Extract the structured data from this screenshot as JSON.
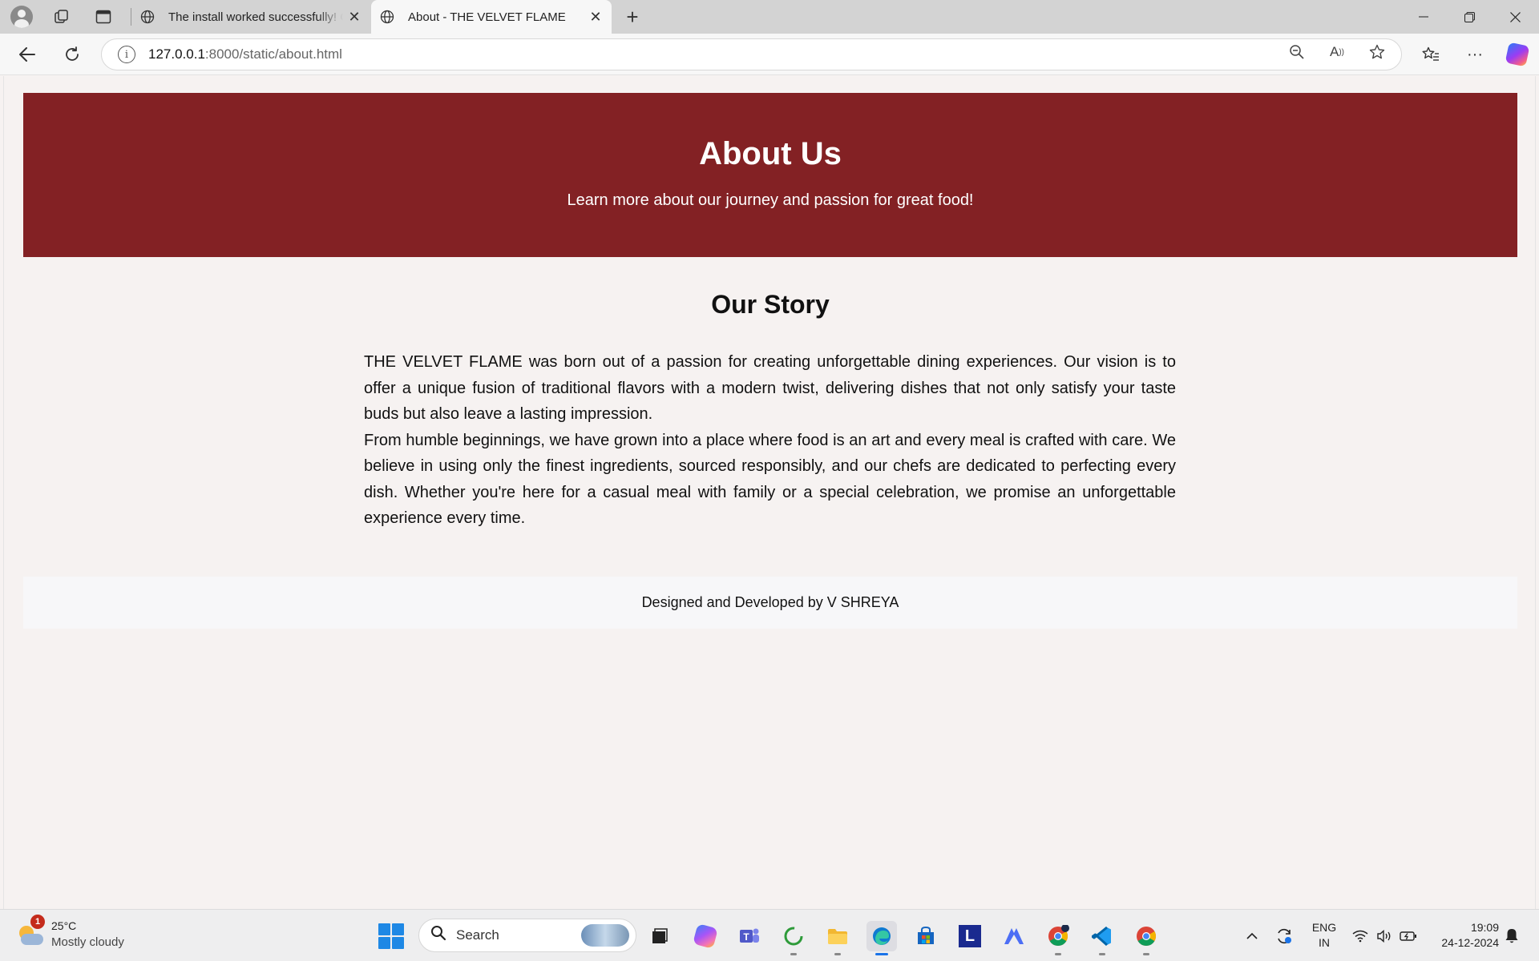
{
  "browser": {
    "tabs": [
      {
        "title": "The install worked successfully! Congratulations!",
        "active": false
      },
      {
        "title": "About - THE VELVET FLAME",
        "active": true
      }
    ],
    "address": {
      "host": "127.0.0.1",
      "path": ":8000/static/about.html"
    },
    "icons": [
      "profile-icon",
      "workspaces-icon",
      "tab-actions-icon",
      "globe-icon",
      "close-icon",
      "new-tab-icon",
      "back-icon",
      "refresh-icon",
      "info-icon",
      "zoom-out-icon",
      "read-aloud-icon",
      "favorite-star-icon",
      "favorites-icon",
      "more-icon",
      "copilot-icon",
      "minimize-icon",
      "restore-icon",
      "window-close-icon"
    ]
  },
  "page": {
    "hero": {
      "title": "About Us",
      "subtitle": "Learn more about our journey and passion for great food!"
    },
    "story": {
      "title": "Our Story",
      "paragraphs": [
        "THE VELVET FLAME was born out of a passion for creating unforgettable dining experiences. Our vision is to offer a unique fusion of traditional flavors with a modern twist, delivering dishes that not only satisfy your taste buds but also leave a lasting impression.",
        "From humble beginnings, we have grown into a place where food is an art and every meal is crafted with care. We believe in using only the finest ingredients, sourced responsibly, and our chefs are dedicated to perfecting every dish. Whether you're here for a casual meal with family or a special celebration, we promise an unforgettable experience every time."
      ]
    },
    "footer": {
      "text": "Designed and Developed by V SHREYA"
    },
    "colors": {
      "hero_bg": "#832124",
      "page_bg": "#f6f2f1",
      "footer_bg": "#f7f7f9"
    }
  },
  "taskbar": {
    "weather": {
      "badge": "1",
      "temp": "25°C",
      "condition": "Mostly cloudy"
    },
    "search": {
      "label": "Search"
    },
    "apps": [
      "file-explorer-dark-icon",
      "copilot-icon",
      "teams-icon",
      "refresh-app-icon",
      "folder-icon",
      "edge-icon",
      "store-icon",
      "l-app-icon",
      "vpn-icon",
      "chrome-icon",
      "vscode-icon",
      "chrome-icon"
    ],
    "tray": {
      "lang_line1": "ENG",
      "lang_line2": "IN",
      "time": "19:09",
      "date": "24-12-2024"
    }
  }
}
